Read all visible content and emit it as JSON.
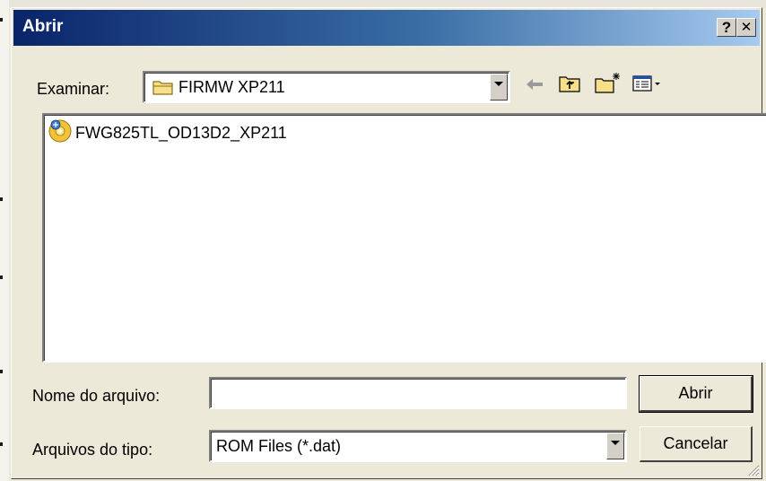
{
  "dialog": {
    "title": "Abrir",
    "help_button": "?",
    "close_button": "✕"
  },
  "look_in": {
    "label": "Examinar:",
    "value": "FIRMW XP211",
    "icon": "folder-icon"
  },
  "toolbar": {
    "icons": [
      "back-arrow-icon",
      "up-one-level-icon",
      "create-new-folder-icon",
      "view-menu-icon"
    ]
  },
  "file_list": {
    "items": [
      {
        "name": "FWG825TL_OD13D2_XP211",
        "icon": "disc-file-icon"
      }
    ]
  },
  "file_name": {
    "label": "Nome do arquivo:",
    "value": ""
  },
  "file_type": {
    "label": "Arquivos do tipo:",
    "value": "ROM Files (*.dat)"
  },
  "buttons": {
    "open": "Abrir",
    "cancel": "Cancelar"
  },
  "colors": {
    "titlebar_start": "#0a246a",
    "titlebar_end": "#a6caf0",
    "face": "#ece9d8"
  }
}
